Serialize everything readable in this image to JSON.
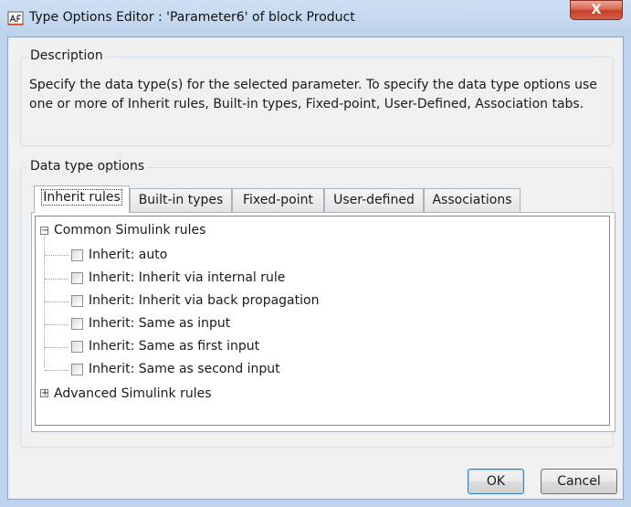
{
  "window": {
    "title": "Type Options Editor : 'Parameter6' of block Product",
    "close_label": "X"
  },
  "description": {
    "group_label": "Description",
    "text": "Specify the data type(s) for the selected parameter. To specify the data type options use one or more of Inherit rules, Built-in types, Fixed-point, User-Defined, Association tabs."
  },
  "options": {
    "group_label": "Data type options",
    "tabs": [
      {
        "label": "Inherit rules"
      },
      {
        "label": "Built-in types"
      },
      {
        "label": "Fixed-point"
      },
      {
        "label": "User-defined"
      },
      {
        "label": "Associations"
      }
    ],
    "active_tab": "Inherit rules"
  },
  "tree": {
    "common": {
      "label": "Common Simulink rules",
      "expander": "−",
      "items": [
        {
          "label": "Inherit: auto",
          "checked": false
        },
        {
          "label": "Inherit: Inherit via internal rule",
          "checked": false
        },
        {
          "label": "Inherit: Inherit via back propagation",
          "checked": false
        },
        {
          "label": "Inherit: Same as input",
          "checked": false
        },
        {
          "label": "Inherit: Same as first input",
          "checked": false
        },
        {
          "label": "Inherit: Same as second input",
          "checked": false
        }
      ]
    },
    "advanced": {
      "label": "Advanced Simulink rules",
      "expander": "+"
    }
  },
  "buttons": {
    "ok": "OK",
    "cancel": "Cancel"
  }
}
